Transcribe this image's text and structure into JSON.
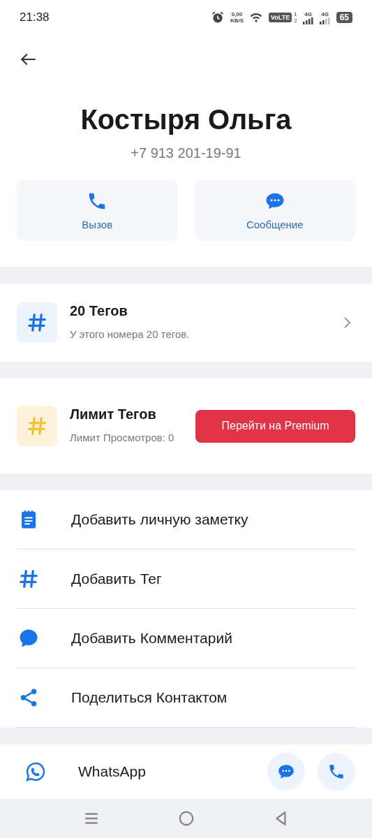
{
  "status_bar": {
    "time": "21:38",
    "speed_value": "0,00",
    "speed_unit": "KB/S",
    "volte": "VoLTE",
    "sim_1": "1",
    "sim_2": "2",
    "network_1": "4G",
    "network_2": "4G",
    "battery": "65"
  },
  "contact": {
    "name": "Костыря Ольга",
    "phone": "+7 913 201-19-91"
  },
  "actions": [
    {
      "kind": "call",
      "label": "Вызов"
    },
    {
      "kind": "message",
      "label": "Сообщение"
    }
  ],
  "tags": {
    "title": "20 Тегов",
    "subtitle": "У этого номера 20 тегов."
  },
  "limit": {
    "title": "Лимит Тегов",
    "subtitle": "Лимит Просмотров: 0",
    "button": "Перейти на Premium"
  },
  "menu": [
    {
      "kind": "note",
      "label": "Добавить личную заметку"
    },
    {
      "kind": "tag",
      "label": "Добавить Тег"
    },
    {
      "kind": "comment",
      "label": "Добавить Комментарий"
    },
    {
      "kind": "share",
      "label": "Поделиться Контактом"
    }
  ],
  "whatsapp": {
    "label": "WhatsApp"
  }
}
